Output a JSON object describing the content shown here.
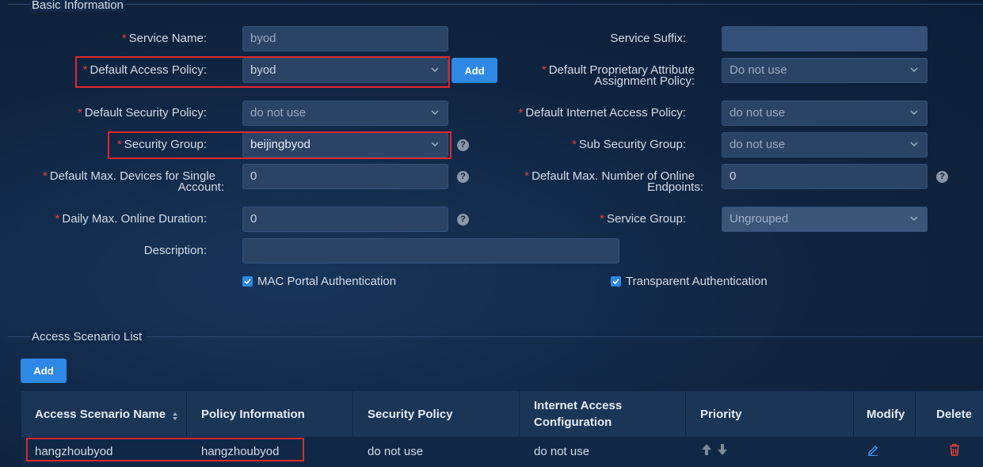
{
  "basic_info": {
    "section_title": "Basic Information",
    "required_mark": "*",
    "service_name": {
      "label": "Service Name:",
      "value": "byod"
    },
    "service_suffix": {
      "label": "Service Suffix:",
      "value": ""
    },
    "default_access_policy": {
      "label": "Default Access Policy:",
      "value": "byod",
      "add_label": "Add"
    },
    "default_proprietary_policy": {
      "label_line1": "Default Proprietary Attribute",
      "label_line2": "Assignment Policy:",
      "value": "Do not use"
    },
    "default_security_policy": {
      "label": "Default Security Policy:",
      "value": "do not use"
    },
    "default_internet_policy": {
      "label": "Default Internet Access Policy:",
      "value": "do not use"
    },
    "security_group": {
      "label": "Security Group:",
      "value": "beijingbyod",
      "help": "?"
    },
    "sub_security_group": {
      "label": "Sub Security Group:",
      "value": "do not use"
    },
    "max_devices": {
      "label_line1": "Default Max. Devices for Single",
      "label_line2": "Account:",
      "value": "0",
      "help": "?"
    },
    "max_online_endpoints": {
      "label_line1": "Default Max. Number of Online",
      "label_line2": "Endpoints:",
      "value": "0",
      "help": "?"
    },
    "daily_max_duration": {
      "label": "Daily Max. Online Duration:",
      "value": "0",
      "help": "?"
    },
    "service_group": {
      "label": "Service Group:",
      "value": "Ungrouped"
    },
    "description": {
      "label": "Description:",
      "value": ""
    },
    "mac_portal_auth": {
      "label": "MAC Portal Authentication",
      "checked": true
    },
    "transparent_auth": {
      "label": "Transparent Authentication",
      "checked": true
    }
  },
  "access_scenario": {
    "section_title": "Access Scenario List",
    "add_label": "Add",
    "columns": {
      "name": "Access Scenario Name",
      "policy": "Policy Information",
      "security": "Security Policy",
      "internet_line1": "Internet Access",
      "internet_line2": "Configuration",
      "priority": "Priority",
      "modify": "Modify",
      "delete": "Delete"
    },
    "rows": [
      {
        "name": "hangzhoubyod",
        "policy": "hangzhoubyod",
        "security": "do not use",
        "internet": "do not use"
      }
    ]
  },
  "colors": {
    "accent": "#2d88e6",
    "highlight": "#e0262d",
    "delete": "#e8413c"
  },
  "icons": [
    "chevron-down-icon",
    "help-icon",
    "check-icon",
    "sort-icon",
    "arrow-up-icon",
    "arrow-down-icon",
    "edit-icon",
    "trash-icon"
  ]
}
